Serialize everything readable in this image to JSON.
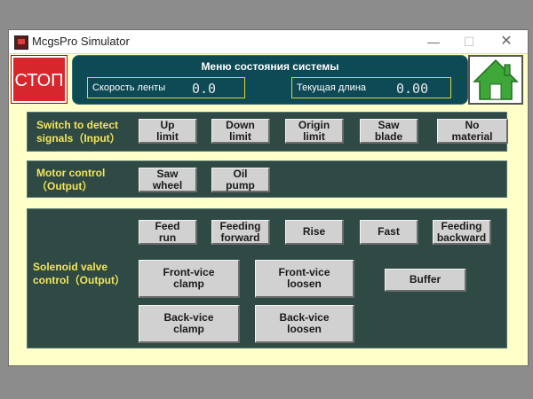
{
  "window": {
    "title": "McgsPro Simulator",
    "controls": {
      "minimize": "—",
      "maximize": "☐",
      "close": "✕"
    }
  },
  "stop_button": {
    "label": "СТОП",
    "color": "#d7262c"
  },
  "status": {
    "title": "Меню состояния системы",
    "belt_speed": {
      "label": "Скорость ленты",
      "value": "0.0"
    },
    "current_length": {
      "label": "Текущая длина",
      "value": "0.00"
    }
  },
  "home_button": {
    "icon": "home-icon",
    "color": "#3fa63a"
  },
  "input_signals": {
    "title": "Switch to detect\nsignals（Input）",
    "buttons": [
      "Up\nlimit",
      "Down\nlimit",
      "Origin\nlimit",
      "Saw\nblade",
      "No\nmaterial"
    ]
  },
  "motor_control": {
    "title": "Motor control\n（Output）",
    "buttons": [
      "Saw\nwheel",
      "Oil\npump"
    ]
  },
  "solenoid": {
    "title": "Solenoid valve\ncontrol（Output）",
    "row1": [
      "Feed\nrun",
      "Feeding\nforward",
      "Rise",
      "Fast",
      "Feeding\nbackward"
    ],
    "front_vice_clamp": "Front-vice\nclamp",
    "front_vice_loosen": "Front-vice\nloosen",
    "buffer": "Buffer",
    "back_vice_clamp": "Back-vice\nclamp",
    "back_vice_loosen": "Back-vice\nloosen"
  },
  "colors": {
    "panel_bg": "#2f4944",
    "window_bg": "#ffffc8",
    "label_yellow": "#f2e65a",
    "status_bg": "#0d4a55"
  }
}
